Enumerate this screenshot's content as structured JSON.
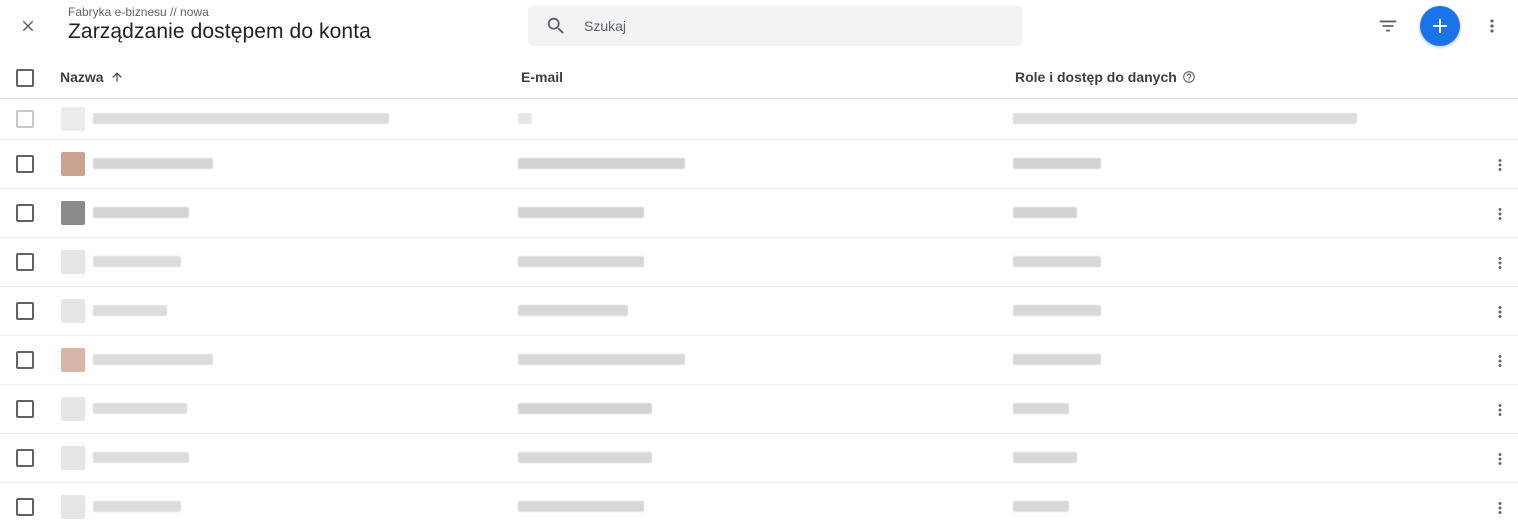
{
  "header": {
    "breadcrumb": "Fabryka e-biznesu // nowa",
    "title": "Zarządzanie dostępem do konta",
    "search_placeholder": "Szukaj"
  },
  "table": {
    "columns": {
      "name": "Nazwa",
      "email": "E-mail",
      "roles": "Role i dostęp do danych"
    }
  },
  "colors": {
    "accent": "#1a73e8",
    "icon": "#5f6368"
  },
  "icons": [
    "close-icon",
    "search-icon",
    "filter-icon",
    "add-icon",
    "more-vert-icon",
    "arrow-upward-icon",
    "help-outline-icon"
  ]
}
